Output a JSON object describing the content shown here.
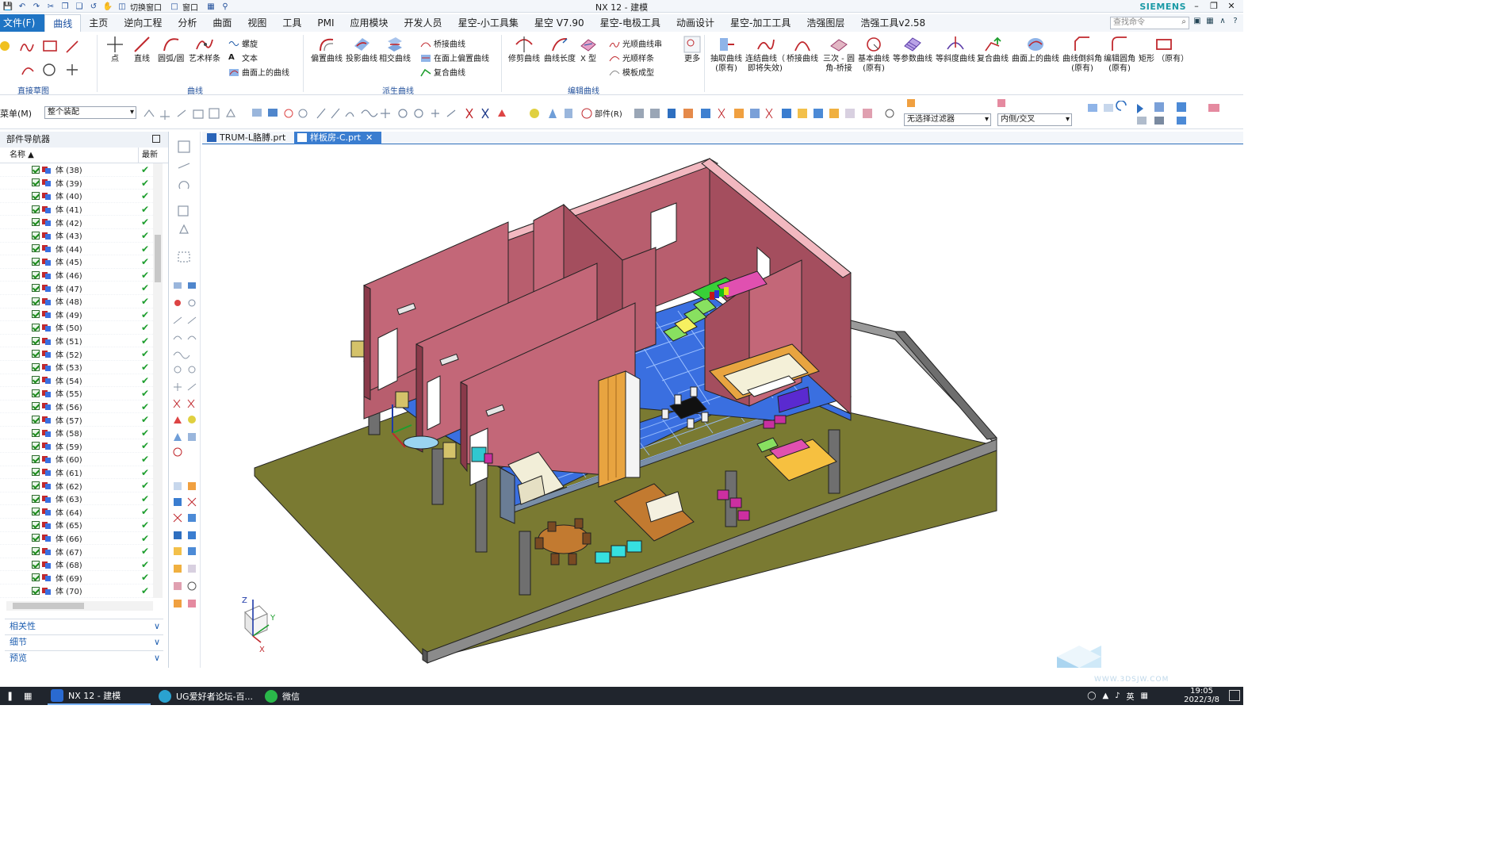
{
  "window": {
    "title": "NX 12 - 建模",
    "brand": "SIEMENS",
    "switch_window": "切换窗口",
    "window_menu": "窗口"
  },
  "tabs": [
    "文件(F)",
    "曲线",
    "主页",
    "逆向工程",
    "分析",
    "曲面",
    "视图",
    "工具",
    "PMI",
    "应用模块",
    "开发人员",
    "星空-小工具集",
    "星空 V7.90",
    "星空-电极工具",
    "动画设计",
    "星空-加工工具",
    "浩强图层",
    "浩强工具v2.58"
  ],
  "active_tab": "曲线",
  "command_search_placeholder": "查找命令",
  "ribbon": {
    "direct_sketch": "直接草图",
    "curve_group": "曲线",
    "derived_group": "派生曲线",
    "edit_group": "编辑曲线",
    "point": "点",
    "line": "直线",
    "arc": "圆弧/圆",
    "studio_spline": "艺术样条",
    "helix": "螺旋",
    "text": "文本",
    "curve_on_surface": "曲面上的曲线",
    "offset_curve": "偏置曲线",
    "project_curve": "投影曲线",
    "intersect_curve": "相交曲线",
    "bridge_curve": "桥接曲线",
    "offset_in_face": "在面上偏置曲线",
    "composite_curve": "复合曲线",
    "trim_curve": "修剪曲线",
    "curve_length": "曲线长度",
    "x_form": "X 型",
    "smooth_string": "光顺曲线串",
    "smooth_spline": "光顺样条",
    "template_shape": "模板成型",
    "more": "更多",
    "extract_curve": "抽取曲线",
    "extract_curve2": "(原有)",
    "connect_curve": "连结曲线（",
    "connect_curve2": "即将失效)",
    "bridge_curve2": "桥接曲线",
    "cubic_bridge": "三次 - 圆",
    "cubic_bridge2": "角-桥接",
    "basic_curve": "基本曲线",
    "basic_curve2": "(原有)",
    "iso_curve": "等参数曲线",
    "isocline": "等斜度曲线",
    "composite_curve2": "复合曲线",
    "curve_on_face": "曲面上的曲线",
    "curve_chamfer": "曲线倒斜角",
    "curve_chamfer2": "(原有)",
    "edit_fillet": "编辑圆角",
    "edit_fillet2": "(原有)",
    "rectangle": "矩形 （原有）"
  },
  "selection_bar": {
    "menu": "菜单(M)",
    "scope": "整个装配",
    "filter": "无选择过滤器",
    "inside": "内侧/交叉",
    "part_menu": "部件(R)"
  },
  "navigator": {
    "title": "部件导航器",
    "col_name": "名称",
    "col_latest": "最新",
    "bodies": [
      "体 (38)",
      "体 (39)",
      "体 (40)",
      "体 (41)",
      "体 (42)",
      "体 (43)",
      "体 (44)",
      "体 (45)",
      "体 (46)",
      "体 (47)",
      "体 (48)",
      "体 (49)",
      "体 (50)",
      "体 (51)",
      "体 (52)",
      "体 (53)",
      "体 (54)",
      "体 (55)",
      "体 (56)",
      "体 (57)",
      "体 (58)",
      "体 (59)",
      "体 (60)",
      "体 (61)",
      "体 (62)",
      "体 (63)",
      "体 (64)",
      "体 (65)",
      "体 (66)",
      "体 (67)",
      "体 (68)",
      "体 (69)",
      "体 (70)"
    ],
    "panels": [
      "相关性",
      "细节",
      "预览"
    ]
  },
  "doc_tabs": [
    "TRUM-L胳膊.prt",
    "样板房-C.prt"
  ],
  "active_doc": "样板房-C.prt",
  "triad": {
    "x": "X",
    "y": "Y",
    "z": "Z"
  },
  "taskbar": {
    "apps": [
      "NX 12 - 建模",
      "UG爱好者论坛-百...",
      "微信"
    ],
    "ime": "英",
    "time": "19:05",
    "date": "2022/3/8",
    "watermark": "WWW.3DSJW.COM"
  },
  "colors": {
    "accent": "#1f74c4",
    "wall": "#b85e6e",
    "wall_top": "#f2b8c0",
    "floor": "#3a6fe0",
    "ground": "#7a7a32",
    "fence": "#8b8b8b"
  }
}
